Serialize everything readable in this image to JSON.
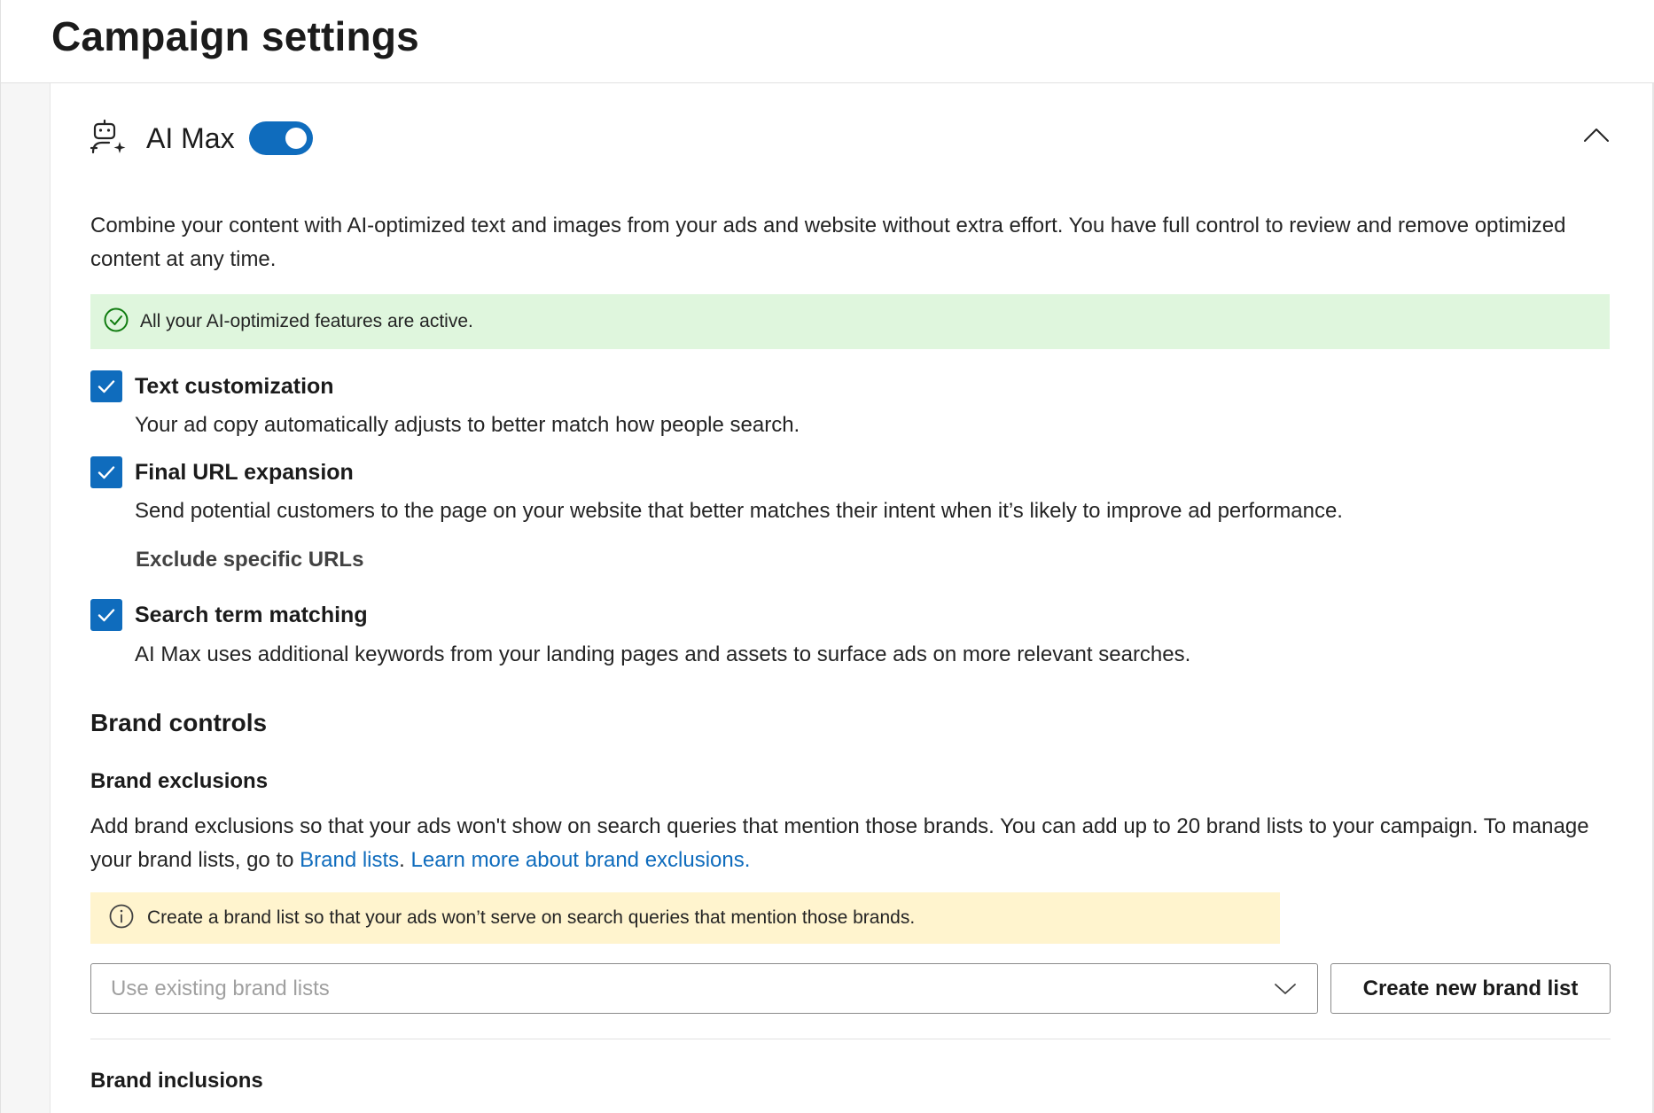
{
  "page": {
    "title": "Campaign settings"
  },
  "ai_max": {
    "title": "AI Max",
    "enabled": true,
    "description": "Combine your content with AI-optimized text and images from your ads and website without extra effort. You have full control to review and remove optimized content at any time.",
    "status_banner": "All your AI-optimized features are active.",
    "features": [
      {
        "label": "Text customization",
        "description": "Your ad copy automatically adjusts to better match how people search.",
        "checked": true
      },
      {
        "label": "Final URL expansion",
        "description": "Send potential customers to the page on your website that better matches their intent when it’s likely to improve ad performance.",
        "checked": true,
        "sub_link": "Exclude specific URLs"
      },
      {
        "label": "Search term matching",
        "description": "AI Max uses additional keywords from your landing pages and assets to surface ads on more relevant searches.",
        "checked": true
      }
    ]
  },
  "brand_controls": {
    "title": "Brand controls",
    "exclusions": {
      "title": "Brand exclusions",
      "description_start": "Add brand exclusions so that your ads won't show on search queries that mention those brands. You can add up to 20 brand lists to your campaign. To manage your brand lists, go to ",
      "link_brand_lists": "Brand lists",
      "separator": ". ",
      "link_learn_more": "Learn more about brand exclusions.",
      "info_banner": "Create a brand list so that your ads won’t serve on search queries that mention those brands.",
      "select_placeholder": "Use existing brand lists",
      "create_button": "Create new brand list"
    },
    "inclusions": {
      "title": "Brand inclusions"
    }
  },
  "colors": {
    "accent": "#0f6cbd",
    "success_bg": "#dff6dd",
    "success_icon": "#107c10",
    "warning_bg": "#fff4ce"
  },
  "icons": {
    "ai_max": "robot-sparkle-icon",
    "collapse": "chevron-up-icon",
    "success": "checkmark-circle-icon",
    "info": "info-icon",
    "dropdown": "chevron-down-icon",
    "checkbox": "checkmark-icon"
  }
}
